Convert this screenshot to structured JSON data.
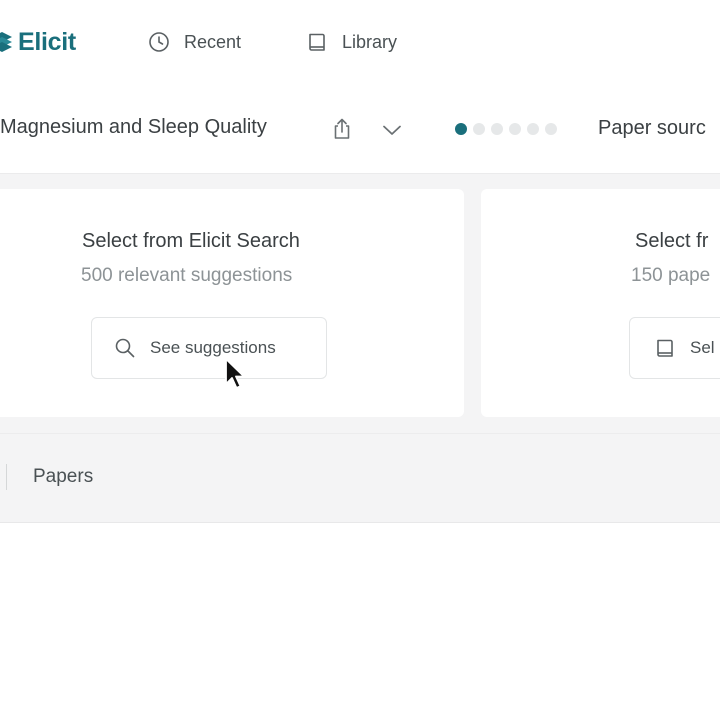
{
  "brand": {
    "name": "Elicit",
    "color": "#1a6f7c",
    "logo_icon": "elicit-logo-icon"
  },
  "nav": {
    "recent": {
      "label": "Recent",
      "icon": "clock-icon"
    },
    "library": {
      "label": "Library",
      "icon": "book-icon"
    }
  },
  "project": {
    "title": "Magnesium and Sleep Quality",
    "share_icon": "share-icon",
    "dropdown_icon": "chevron-down-icon",
    "steps": {
      "total": 6,
      "current": 1
    },
    "next_step_label": "Paper sourc"
  },
  "sources": [
    {
      "title": "Select from Elicit Search",
      "subtitle": "500 relevant suggestions",
      "button_label": "See suggestions",
      "button_icon": "search-icon"
    },
    {
      "title": "Select fr",
      "subtitle": "150 pape",
      "button_label": "Sel",
      "button_icon": "book-icon"
    }
  ],
  "papers": {
    "label": "Papers"
  },
  "colors": {
    "accent": "#1a6f7c",
    "muted_text": "#8d9396",
    "panel_background": "#f4f4f5",
    "dot_inactive": "#e6e8e9"
  }
}
